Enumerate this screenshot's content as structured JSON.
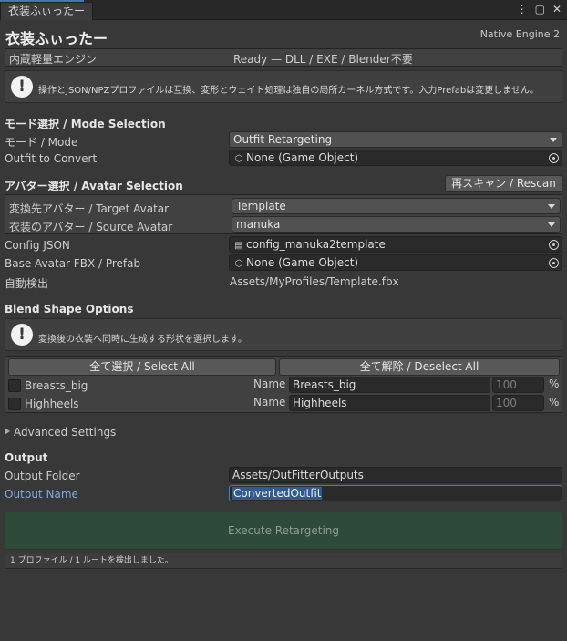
{
  "window": {
    "tab_title": "衣装ふぃったー",
    "controls": [
      "⋮",
      "▢",
      "✕"
    ]
  },
  "header": {
    "title": "衣装ふぃったー",
    "engine": "Native Engine 2"
  },
  "engine_row": {
    "label": "内蔵軽量エンジン",
    "value": "Ready — DLL / EXE / Blender不要"
  },
  "help1": {
    "icon": "!",
    "text": "操作とJSON/NPZプロファイルは互換、変形とウェイト処理は独自の局所カーネル方式です。入力Prefabは変更しません。"
  },
  "mode": {
    "section": "モード選択 / Mode Selection",
    "mode_label": "モード / Mode",
    "mode_value": "Outfit Retargeting",
    "outfit_label": "Outfit to Convert",
    "outfit_value": "None (Game Object)"
  },
  "avatar": {
    "section": "アバター選択 / Avatar Selection",
    "rescan_label": "再スキャン / Rescan",
    "target_label": "変換先アバター / Target Avatar",
    "target_value": "Template",
    "source_label": "衣装のアバター / Source Avatar",
    "source_value": "manuka",
    "config_label": "Config JSON",
    "config_value": "config_manuka2template",
    "base_label": "Base Avatar FBX / Prefab",
    "base_value": "None (Game Object)",
    "auto_label": "自動検出",
    "auto_value": "Assets/MyProfiles/Template.fbx"
  },
  "blend": {
    "section": "Blend Shape Options",
    "help_icon": "!",
    "help_text": "変換後の衣装へ同時に生成する形状を選択します。",
    "select_all": "全て選択 / Select All",
    "deselect_all": "全て解除 / Deselect All",
    "name_label": "Name",
    "percent": "%",
    "rows": [
      {
        "label": "Breasts_big",
        "name": "Breasts_big",
        "value": "100"
      },
      {
        "label": "Highheels",
        "name": "Highheels",
        "value": "100"
      }
    ]
  },
  "advanced": {
    "label": "Advanced Settings"
  },
  "output": {
    "section": "Output",
    "folder_label": "Output Folder",
    "folder_value": "Assets/OutFitterOutputs",
    "name_label": "Output Name",
    "name_value": "ConvertedOutfit"
  },
  "execute": {
    "label": "Execute Retargeting"
  },
  "status": {
    "text": "1 プロファイル / 1 ルートを検出しました。"
  },
  "colors": {
    "accent": "#3a79bb",
    "execute_bg": "#2e4a3a",
    "link_label": "#7eabe5"
  }
}
